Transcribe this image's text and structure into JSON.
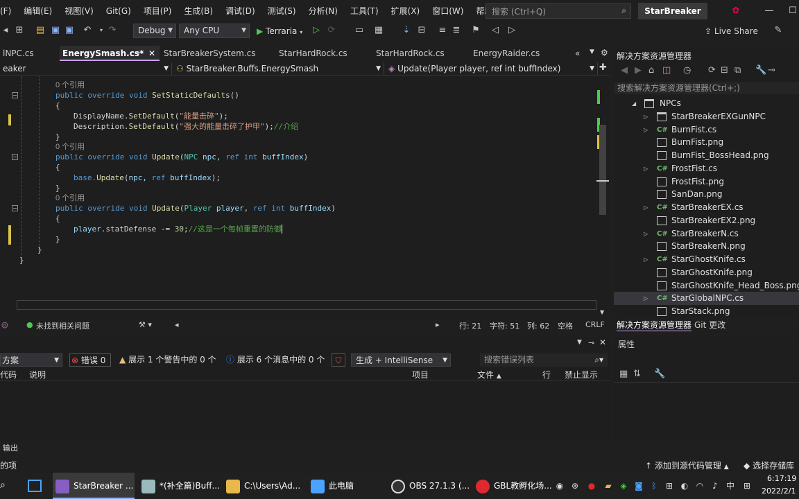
{
  "menubar": {
    "items": [
      "(F)",
      "编辑(E)",
      "视图(V)",
      "Git(G)",
      "项目(P)",
      "生成(B)",
      "调试(D)",
      "测试(S)",
      "分析(N)",
      "工具(T)",
      "扩展(X)",
      "窗口(W)",
      "帮助(H)"
    ],
    "search_placeholder": "搜索 (Ctrl+Q)",
    "solution_name": "StarBreaker"
  },
  "toolbar": {
    "config": "Debug",
    "platform": "Any CPU",
    "start_target": "Terraria",
    "live_share": "Live Share"
  },
  "tabs": [
    "lNPC.cs",
    "EnergySmash.cs*",
    "StarBreakerSystem.cs",
    "StarHardRock.cs",
    "StarHardRock.cs",
    "EnergyRaider.cs"
  ],
  "navbar": {
    "project": "eaker",
    "type": "StarBreaker.Buffs.EnergySmash",
    "member": "Update(Player player, ref int buffIndex)"
  },
  "code": {
    "ref0": "0 个引用",
    "l1_kw": "public override void",
    "l1_fn": "SetStaticDefaults",
    "l1_end": "()",
    "brace_open": "{",
    "brace_close": "}",
    "l3_a": "DisplayName.",
    "l3_fn": "SetDefault",
    "l3_str": "\"能量击碎\"",
    "l3_end": ");",
    "l4_a": "Description.",
    "l4_fn": "SetDefault",
    "l4_str": "\"强大的能量击碎了护甲\"",
    "l4_end": ");",
    "l4_cm": "//介绍",
    "l6_kw": "public override void",
    "l6_fn": "Update",
    "l6_p1": "NPC",
    "l6_p2": "npc,",
    "l6_p3": "ref int",
    "l6_p4": "buffIndex",
    "l8_a": "base.",
    "l8_fn": "Update",
    "l8_p1": "npc,",
    "l8_p2": "ref",
    "l8_p3": "buffIndex",
    "l8_end": ");",
    "l11_kw": "public override void",
    "l11_fn": "Update",
    "l11_p1": "Player",
    "l11_p2": "player,",
    "l11_p3": "ref int",
    "l11_p4": "buffIndex",
    "l13_a": "player",
    "l13_b": ".statDefense -=",
    "l13_num": "30",
    "l13_c": ";",
    "l13_cm": "//这是一个每帧重置的防御"
  },
  "statusline": {
    "issues": "未找到相关问题",
    "line": "行: 21",
    "char": "字符: 51",
    "col": "列: 62",
    "ws": "空格",
    "eol": "CRLF"
  },
  "errorlist": {
    "scope": "方案",
    "errors": "错误 0",
    "warnings": "展示 1 个警告中的 0 个",
    "messages": "展示 6 个消息中的 0 个",
    "build": "生成 + IntelliSense",
    "search": "搜索错误列表",
    "cols": [
      "代码",
      "说明",
      "项目",
      "文件",
      "行",
      "禁止显示"
    ]
  },
  "output_tab": "输出",
  "vs_status": {
    "left": "的项",
    "source_control": "添加到源代码管理",
    "repo": "选择存储库"
  },
  "solution_explorer": {
    "title": "解决方案资源管理器",
    "search": "搜索解决方案资源管理器(Ctrl+;)",
    "items": [
      {
        "name": "NPCs",
        "icon": "folder-icon",
        "exp": "◢"
      },
      {
        "name": "StarBreakerEXGunNPC",
        "icon": "folder-icon",
        "exp": "▷"
      },
      {
        "name": "BurnFist.cs",
        "icon": "cs-icon",
        "exp": "▷"
      },
      {
        "name": "BurnFist.png",
        "icon": "png-icon",
        "exp": ""
      },
      {
        "name": "BurnFist_BossHead.png",
        "icon": "png-icon",
        "exp": ""
      },
      {
        "name": "FrostFist.cs",
        "icon": "cs-icon",
        "exp": "▷"
      },
      {
        "name": "FrostFist.png",
        "icon": "png-icon",
        "exp": ""
      },
      {
        "name": "SanDan.png",
        "icon": "png-icon",
        "exp": ""
      },
      {
        "name": "StarBreakerEX.cs",
        "icon": "cs-icon",
        "exp": "▷"
      },
      {
        "name": "StarBreakerEX2.png",
        "icon": "png-icon",
        "exp": ""
      },
      {
        "name": "StarBreakerN.cs",
        "icon": "cs-icon",
        "exp": "▷"
      },
      {
        "name": "StarBreakerN.png",
        "icon": "png-icon",
        "exp": ""
      },
      {
        "name": "StarGhostKnife.cs",
        "icon": "cs-icon",
        "exp": "▷"
      },
      {
        "name": "StarGhostKnife.png",
        "icon": "png-icon",
        "exp": ""
      },
      {
        "name": "StarGhostKnife_Head_Boss.png",
        "icon": "png-icon",
        "exp": ""
      },
      {
        "name": "StarGlobalNPC.cs",
        "icon": "cs-icon",
        "exp": "▷"
      },
      {
        "name": "StarStack.png",
        "icon": "png-icon",
        "exp": ""
      }
    ],
    "bottom_tabs": [
      "解决方案资源管理器",
      "Git 更改"
    ]
  },
  "properties": {
    "title": "属性"
  },
  "taskbar": {
    "items": [
      "StarBreaker ...",
      "*(补全篇)Buff...",
      "C:\\Users\\Ad...",
      "此电脑",
      "OBS 27.1.3 (...",
      "GBL教孵化场..."
    ],
    "ime": "中",
    "time": "6:17:19",
    "date": "2022/2/1"
  },
  "colors": {
    "accent": "#cf9fff",
    "keyword": "#569cd6",
    "type": "#4ec9b0",
    "string": "#d69d85",
    "comment": "#57a64a"
  }
}
